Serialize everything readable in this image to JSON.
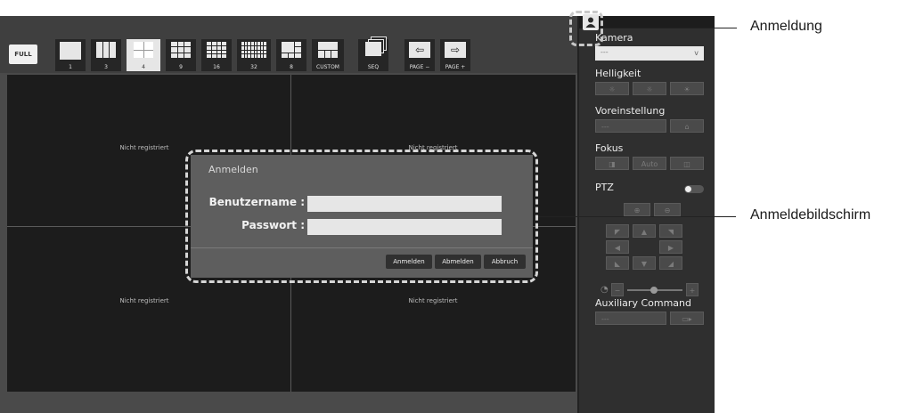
{
  "toolbar": {
    "full": "FULL",
    "layouts": [
      "1",
      "3",
      "4",
      "9",
      "16",
      "32",
      "8",
      "CUSTOM"
    ],
    "seq": "SEQ",
    "page_minus": "PAGE −",
    "page_plus": "PAGE +",
    "selected_layout": "4"
  },
  "cells": [
    "Nicht registriert",
    "Nicht registriert",
    "Nicht registriert",
    "Nicht registriert"
  ],
  "side": {
    "kamera": "Kamera",
    "kamera_value": "---",
    "kamera_arrow": "v",
    "helligkeit": "Helligkeit",
    "voreinstellung": "Voreinstellung",
    "voreinstellung_value": "---",
    "fokus": "Fokus",
    "fokus_buttons": [
      "◨",
      "Auto",
      "◫"
    ],
    "ptz": "PTZ",
    "aux": "Auxiliary Command",
    "aux_value": "---"
  },
  "dialog": {
    "title": "Anmelden",
    "username_label": "Benutzername :",
    "password_label": "Passwort :",
    "username_value": "",
    "password_value": "",
    "login_button": "Anmelden",
    "logout_button": "Abmelden",
    "cancel_button": "Abbruch"
  },
  "callouts": {
    "login_icon": "Anmeldung",
    "login_screen": "Anmeldebildschirm"
  }
}
